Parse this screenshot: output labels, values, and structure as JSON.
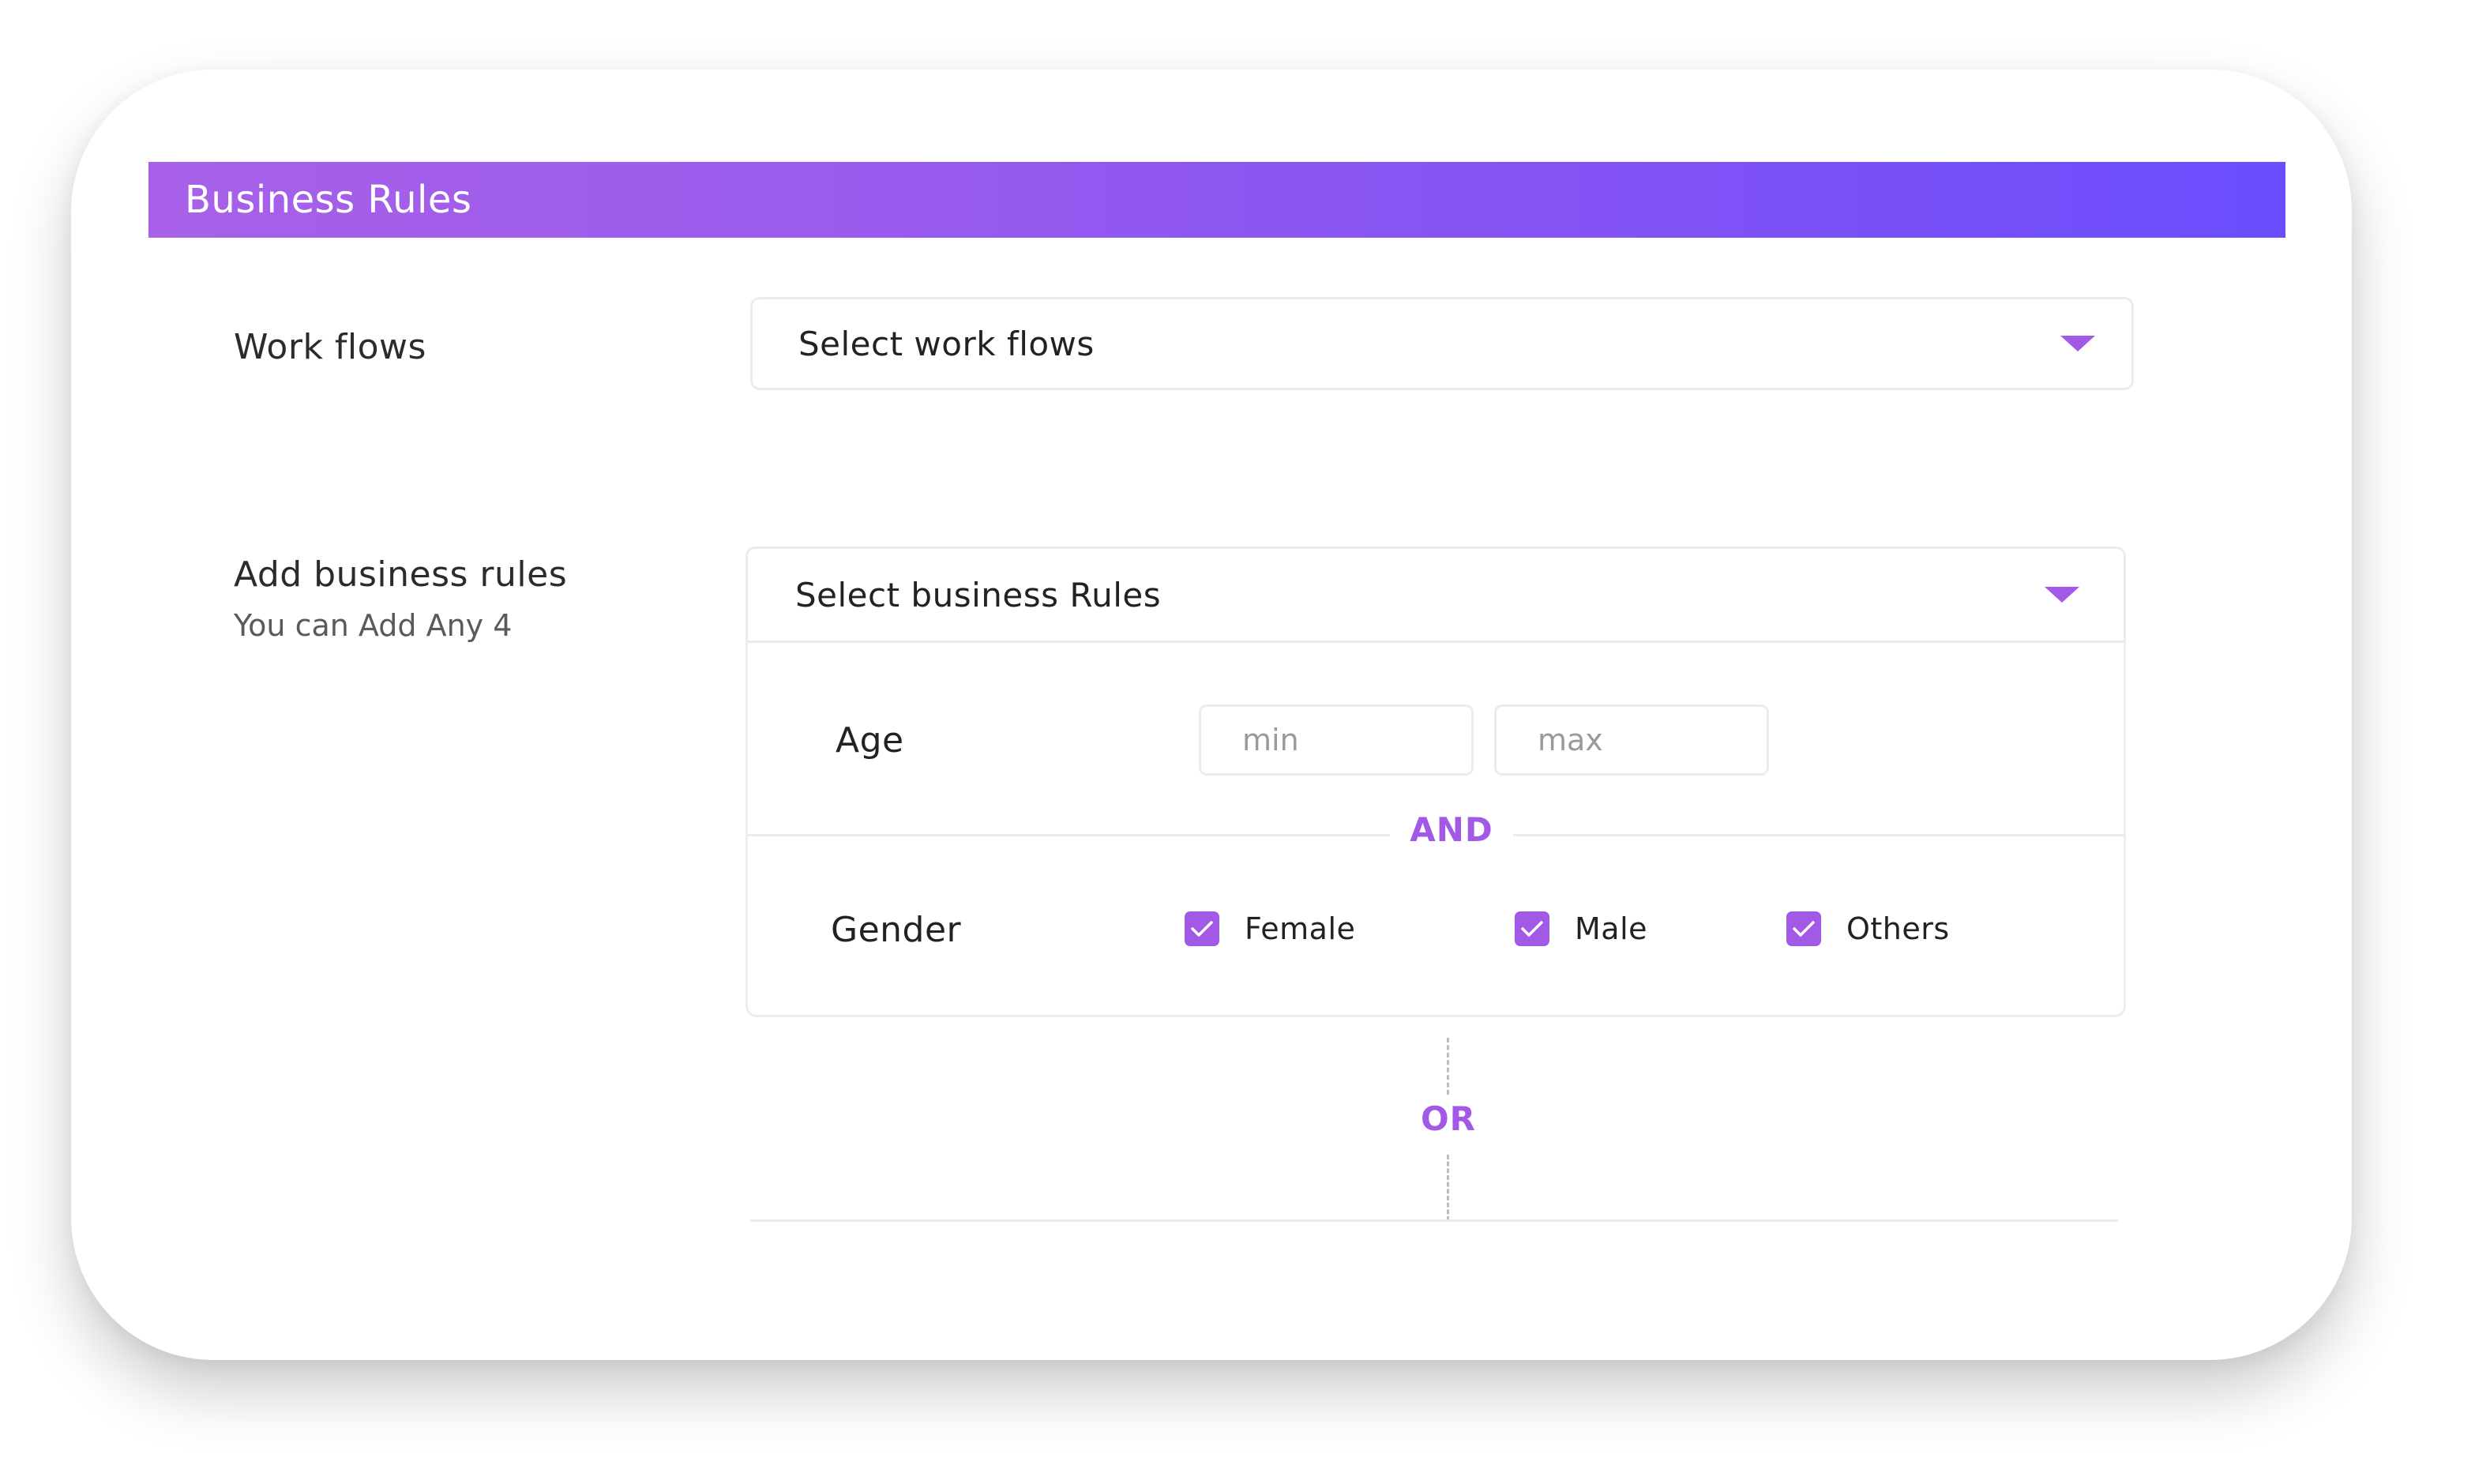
{
  "header": {
    "title": "Business Rules"
  },
  "workflows": {
    "label": "Work flows",
    "select_text": "Select work flows"
  },
  "business_rules": {
    "label": "Add business rules",
    "sublabel": "You can Add Any 4",
    "select_text": "Select business Rules"
  },
  "age": {
    "label": "Age",
    "min_placeholder": "min",
    "max_placeholder": "max"
  },
  "connector_and": "AND",
  "gender": {
    "label": "Gender",
    "options": [
      {
        "label": "Female",
        "checked": true
      },
      {
        "label": "Male",
        "checked": true
      },
      {
        "label": "Others",
        "checked": true
      }
    ]
  },
  "connector_or": "OR",
  "colors": {
    "accent": "#a259e6",
    "header_gradient_start": "#a860e8",
    "header_gradient_end": "#6b4dfd"
  }
}
